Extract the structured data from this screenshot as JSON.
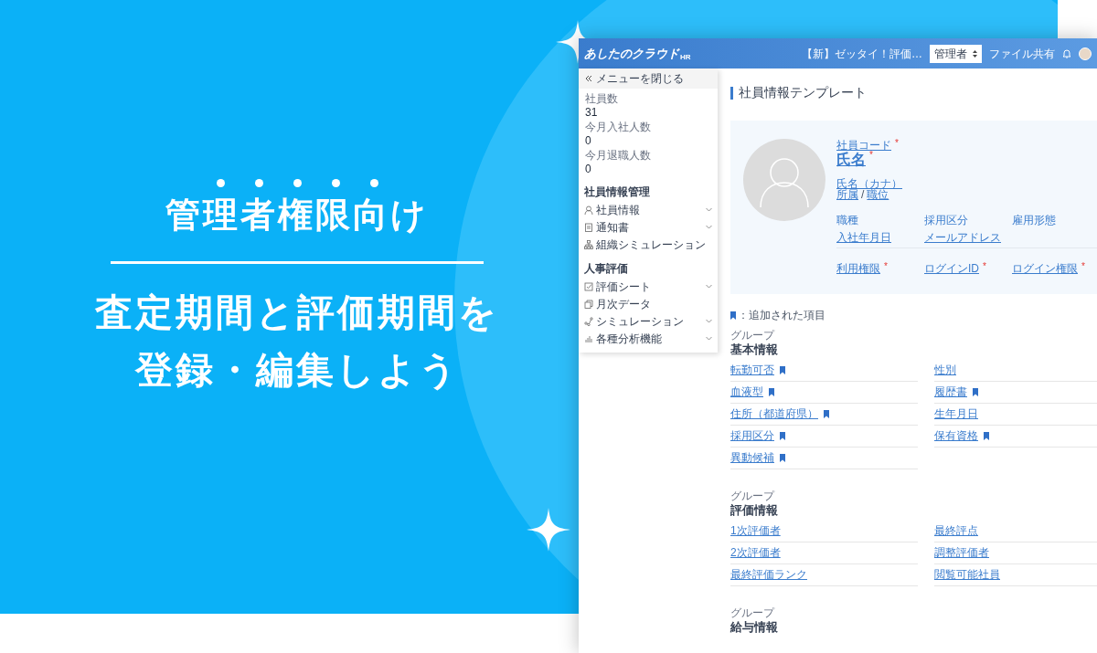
{
  "banner": {
    "headline": "管理者権限向け",
    "lines": [
      "査定期間と評価期間を",
      "登録・編集しよう"
    ]
  },
  "app": {
    "header": {
      "logo": "あしたのクラウド",
      "logo_suffix": "HR",
      "notice": "【新】ゼッタイ！評価…",
      "role_select": "管理者",
      "file_share": "ファイル共有"
    },
    "sidebar": {
      "close_menu": "メニューを閉じる",
      "stats": [
        {
          "label": "社員数",
          "value": "31"
        },
        {
          "label": "今月入社人数",
          "value": "0"
        },
        {
          "label": "今月退職人数",
          "value": "0"
        }
      ],
      "sections": [
        {
          "title": "社員情報管理",
          "items": [
            {
              "label": "社員情報",
              "kind": "person",
              "expandable": true
            },
            {
              "label": "通知書",
              "kind": "document",
              "expandable": true
            },
            {
              "label": "組織シミュレーション",
              "kind": "org",
              "expandable": false
            }
          ]
        },
        {
          "title": "人事評価",
          "items": [
            {
              "label": "評価シート",
              "kind": "check",
              "expandable": true
            },
            {
              "label": "月次データ",
              "kind": "copy",
              "expandable": false
            },
            {
              "label": "シミュレーション",
              "kind": "nodes",
              "expandable": true
            },
            {
              "label": "各種分析機能",
              "kind": "bars",
              "expandable": true
            }
          ]
        }
      ]
    },
    "main": {
      "title": "社員情報テンプレート",
      "required_mark": "*",
      "profile": {
        "code": {
          "label": "社員コード",
          "required": true
        },
        "name": {
          "label": "氏名",
          "required": true
        },
        "kana": "氏名（カナ）",
        "department": "所属",
        "separator": "/",
        "position": "職位",
        "fields": [
          {
            "label": "職種",
            "linked": false
          },
          {
            "label": "採用区分",
            "linked": false
          },
          {
            "label": "雇用形態",
            "linked": false
          },
          {
            "label": "入社年月日",
            "linked": true
          },
          {
            "label": "メールアドレス",
            "linked": true
          }
        ],
        "access_fields": [
          {
            "label": "利用権限",
            "required": true
          },
          {
            "label": "ログインID",
            "required": true
          },
          {
            "label": "ログイン権限",
            "required": true
          }
        ]
      },
      "legend": "：追加された項目",
      "groups": [
        {
          "caption": "グループ",
          "title": "基本情報",
          "fields": [
            {
              "label": "転勤可否",
              "added": true
            },
            {
              "label": "性別",
              "added": false
            },
            {
              "label": "血液型",
              "added": true
            },
            {
              "label": "履歴書",
              "added": true
            },
            {
              "label": "住所（都道府県）",
              "added": true
            },
            {
              "label": "生年月日",
              "added": false
            },
            {
              "label": "採用区分",
              "added": true
            },
            {
              "label": "保有資格",
              "added": true
            },
            {
              "label": "異動候補",
              "added": true
            }
          ]
        },
        {
          "caption": "グループ",
          "title": "評価情報",
          "fields": [
            {
              "label": "1次評価者",
              "added": false
            },
            {
              "label": "最終評点",
              "added": false
            },
            {
              "label": "2次評価者",
              "added": false
            },
            {
              "label": "調整評価者",
              "added": false
            },
            {
              "label": "最終評価ランク",
              "added": false
            },
            {
              "label": "閲覧可能社員",
              "added": false
            }
          ]
        },
        {
          "caption": "グループ",
          "title": "給与情報"
        }
      ]
    }
  }
}
